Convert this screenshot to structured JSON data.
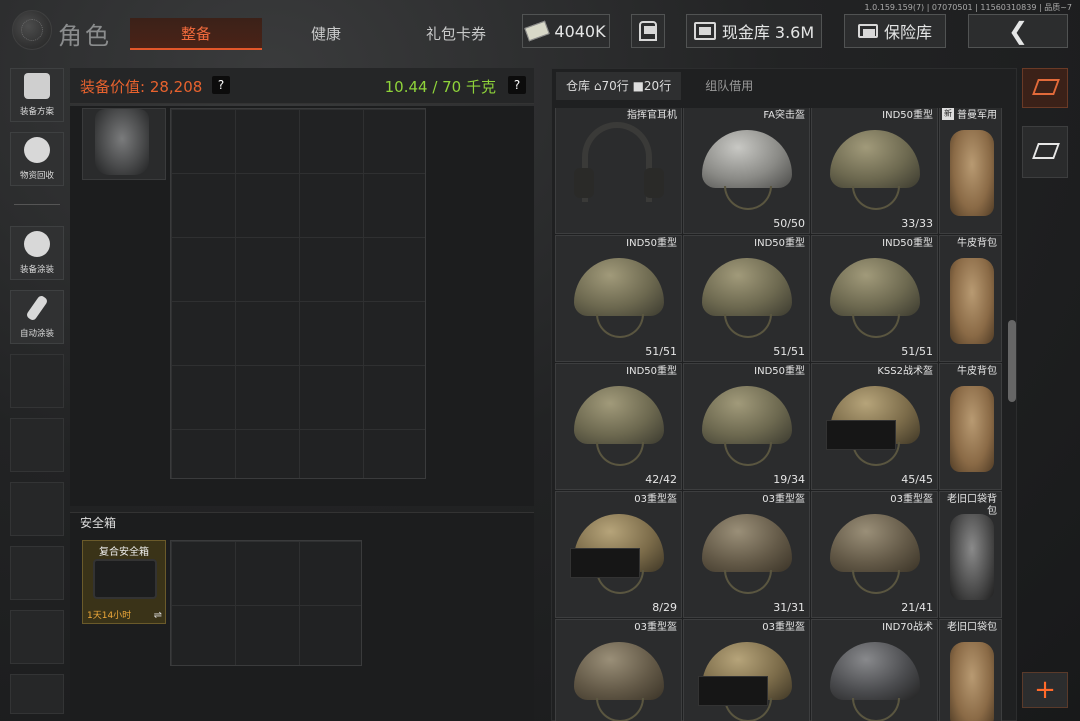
{
  "version": "1.0.159.159(7) | 07070501 | 11560310839 | 品质~7",
  "header": {
    "title": "角色",
    "tabs": [
      "整备",
      "健康",
      "礼包卡券"
    ],
    "currency": "4040K",
    "cash_label": "现金库 3.6M",
    "insurance_label": "保险库",
    "dots": "•••"
  },
  "sidebar": {
    "items": [
      {
        "label": "装备方案",
        "icon": "gear-set-icon"
      },
      {
        "label": "物资回收",
        "icon": "recycle-icon"
      },
      {
        "label": "装备涂装",
        "icon": "paint-icon"
      },
      {
        "label": "自动涂装",
        "icon": "spray-icon"
      }
    ]
  },
  "equip": {
    "value_label": "装备价值: 28,208",
    "weight_label": "10.44 / 70 千克",
    "help": "?"
  },
  "safe": {
    "title": "安全箱",
    "box_name": "复合安全箱",
    "timer": "1天14小时",
    "swap": "⇌"
  },
  "warehouse": {
    "tabs": {
      "main": "仓库",
      "home_rows": "70行",
      "bag_rows": "20行",
      "team": "组队借用"
    },
    "items": [
      {
        "name": "指挥官耳机",
        "qty": "",
        "kind": "headset"
      },
      {
        "name": "FA突击盔",
        "qty": "50/50",
        "kind": "grey"
      },
      {
        "name": "IND50重型",
        "qty": "33/33",
        "kind": "tan"
      },
      {
        "name": "普曼军用",
        "qty": "",
        "kind": "bag",
        "new": "新"
      },
      {
        "name": "IND50重型",
        "qty": "51/51",
        "kind": "tan"
      },
      {
        "name": "IND50重型",
        "qty": "51/51",
        "kind": "tan"
      },
      {
        "name": "IND50重型",
        "qty": "51/51",
        "kind": "tan-nv"
      },
      {
        "name": "牛皮背包",
        "qty": "",
        "kind": "bag"
      },
      {
        "name": "IND50重型",
        "qty": "42/42",
        "kind": "tan"
      },
      {
        "name": "IND50重型",
        "qty": "19/34",
        "kind": "tan"
      },
      {
        "name": "KSS2战术盔",
        "qty": "45/45",
        "kind": "camo-visor"
      },
      {
        "name": "牛皮背包",
        "qty": "",
        "kind": "bag"
      },
      {
        "name": "03重型盔",
        "qty": "8/29",
        "kind": "camo-visor"
      },
      {
        "name": "03重型盔",
        "qty": "31/31",
        "kind": "mesh"
      },
      {
        "name": "03重型盔",
        "qty": "21/41",
        "kind": "mesh"
      },
      {
        "name": "老旧口袋背包",
        "qty": "",
        "kind": "bag-dark"
      },
      {
        "name": "03重型盔",
        "qty": "",
        "kind": "mesh"
      },
      {
        "name": "03重型盔",
        "qty": "",
        "kind": "camo-visor"
      },
      {
        "name": "IND70战术",
        "qty": "",
        "kind": "dark"
      },
      {
        "name": "老旧口袋包",
        "qty": "",
        "kind": "bag"
      }
    ]
  },
  "add_label": "+"
}
